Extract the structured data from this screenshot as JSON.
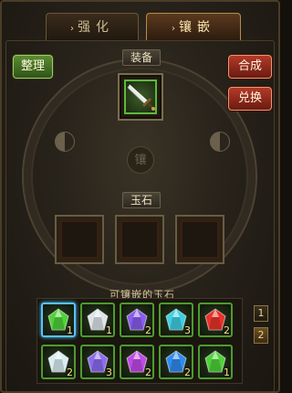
{
  "tabs": [
    {
      "label": "强化",
      "active": false
    },
    {
      "label": "镶嵌",
      "active": true
    }
  ],
  "buttons": {
    "sort": "整理",
    "combine": "合成",
    "exchange": "兑换"
  },
  "equipment": {
    "label": "装备",
    "item_icon": "sword-icon"
  },
  "center_glyph": "镶",
  "gem_section": {
    "label": "玉石",
    "slots": [
      {},
      {},
      {}
    ]
  },
  "inventory": {
    "title": "可镶嵌的玉石",
    "pages": [
      "1",
      "2"
    ],
    "rows": [
      [
        {
          "color": "#4fd23a",
          "count": "1",
          "selected": true
        },
        {
          "color": "#dfe4ea",
          "count": "1"
        },
        {
          "color": "#8a5cf0",
          "count": "2"
        },
        {
          "color": "#3ed0e4",
          "count": "3"
        },
        {
          "color": "#e8322a",
          "count": "2"
        }
      ],
      [
        {
          "color": "#d9eef2",
          "count": "2"
        },
        {
          "color": "#8c6cf0",
          "count": "3"
        },
        {
          "color": "#c04ae8",
          "count": "2"
        },
        {
          "color": "#2f8cf0",
          "count": "2"
        },
        {
          "color": "#4fd23a",
          "count": "1"
        }
      ]
    ]
  }
}
